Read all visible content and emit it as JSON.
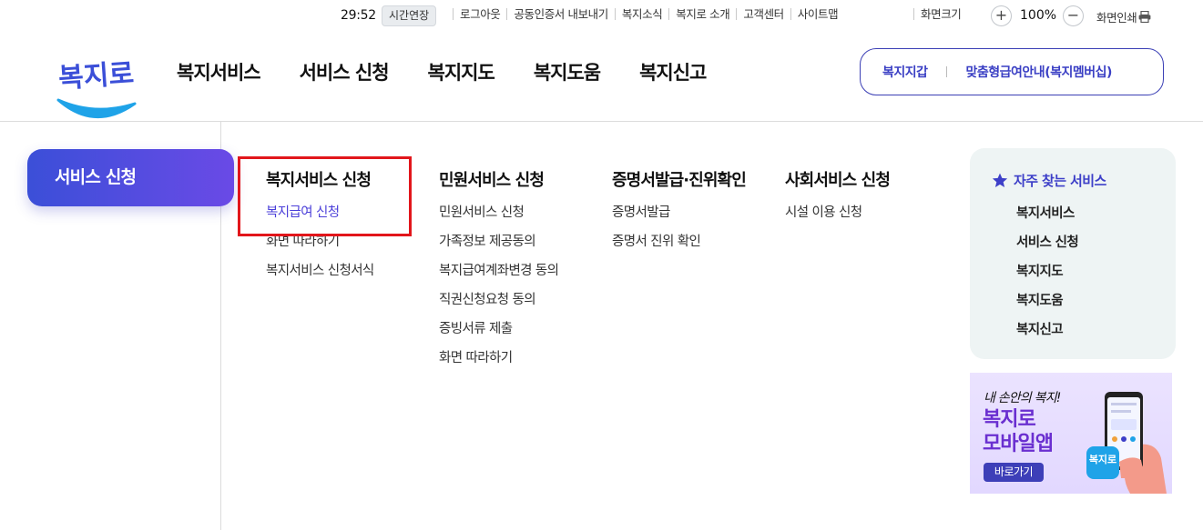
{
  "utility": {
    "timer": "29:52",
    "extend_label": "시간연장",
    "links": [
      "로그아웃",
      "공동인증서 내보내기",
      "복지소식",
      "복지로 소개",
      "고객센터",
      "사이트맵"
    ],
    "font_size_label": "화면크기",
    "zoom_in": "+",
    "zoom_value": "100%",
    "zoom_out": "−",
    "print_label": "화면인쇄"
  },
  "brand": {
    "logo_text": "복지로",
    "accent": "#3b4fd8",
    "logo_smile": "#1fa3e8"
  },
  "gnb": [
    "복지서비스",
    "서비스 신청",
    "복지지도",
    "복지도움",
    "복지신고"
  ],
  "quick": {
    "wallet": "복지지갑",
    "membership": "맞춤형급여안내(복지멤버십)"
  },
  "side_menu": {
    "active": "서비스 신청"
  },
  "columns": [
    {
      "title": "복지서비스 신청",
      "items": [
        "복지급여 신청",
        "화면 따라하기",
        "복지서비스 신청서식"
      ]
    },
    {
      "title": "민원서비스 신청",
      "items": [
        "민원서비스 신청",
        "가족정보 제공동의",
        "복지급여계좌변경 동의",
        "직권신청요청 동의",
        "증빙서류 제출",
        "화면 따라하기"
      ]
    },
    {
      "title": "증명서발급·진위확인",
      "items": [
        "증명서발급",
        "증명서 진위 확인"
      ]
    },
    {
      "title": "사회서비스 신청",
      "items": [
        "시설 이용 신청"
      ]
    }
  ],
  "favorites": {
    "title": "자주 찾는 서비스",
    "items": [
      "복지서비스",
      "서비스 신청",
      "복지지도",
      "복지도움",
      "복지신고"
    ]
  },
  "banner": {
    "line1": "내 손안의 복지!",
    "line2": "복지로",
    "line3": "모바일앱",
    "button": "바로가기",
    "app_icon_text": "복지로"
  }
}
